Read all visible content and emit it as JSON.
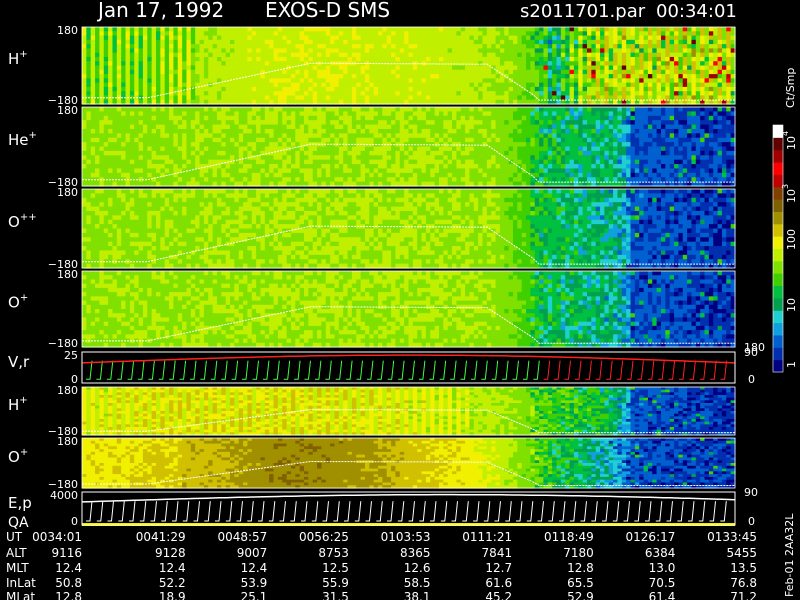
{
  "header": {
    "date": "Jan 17, 1992",
    "mission": "EXOS-D SMS",
    "file": "s2011701.par",
    "time": "00:34:01"
  },
  "colors": {
    "background": "#000000",
    "text": "#ffffff",
    "trace": "#ffffff",
    "vr_red": "#ff2020",
    "vr_green": "#40ff40"
  },
  "colorbar": {
    "unit": "Ct/Smp",
    "tick_labels": [
      "1",
      "10",
      "100",
      "10",
      "4",
      "10",
      "3"
    ],
    "scale": "log",
    "range": [
      1,
      10000
    ],
    "palette": [
      "#000080",
      "#0030b0",
      "#0060d0",
      "#10a0e0",
      "#20d0d0",
      "#00a050",
      "#00c040",
      "#40d000",
      "#80e000",
      "#c0f000",
      "#f0f000",
      "#d0c000",
      "#a09000",
      "#806000",
      "#804000",
      "#c00000",
      "#ff0000",
      "#a00000",
      "#600000",
      "#ffffff"
    ]
  },
  "chart_data": [
    {
      "type": "heatmap",
      "name": "H+",
      "label_main": "H",
      "label_sup": "+",
      "ylim": [
        -180,
        180
      ],
      "y_ticks": [
        "180",
        "−180"
      ],
      "profile": [
        [
          0,
          60
        ],
        [
          0.09,
          60
        ],
        [
          0.14,
          80
        ],
        [
          0.22,
          100
        ],
        [
          0.35,
          120
        ],
        [
          0.48,
          110
        ],
        [
          0.58,
          100
        ],
        [
          0.66,
          70
        ],
        [
          0.7,
          25
        ],
        [
          0.72,
          15
        ],
        [
          0.8,
          110
        ],
        [
          0.88,
          130
        ],
        [
          1,
          140
        ]
      ],
      "pattern": "stripes-both"
    },
    {
      "type": "heatmap",
      "name": "He+",
      "label_main": "He",
      "label_sup": "+",
      "ylim": [
        -180,
        180
      ],
      "y_ticks": [
        "180",
        "−180"
      ],
      "profile": [
        [
          0,
          70
        ],
        [
          0.2,
          75
        ],
        [
          0.35,
          80
        ],
        [
          0.5,
          80
        ],
        [
          0.62,
          75
        ],
        [
          0.67,
          45
        ],
        [
          0.7,
          20
        ],
        [
          0.76,
          18
        ],
        [
          0.82,
          12
        ],
        [
          0.84,
          3
        ],
        [
          1,
          2
        ]
      ],
      "pattern": "noise"
    },
    {
      "type": "heatmap",
      "name": "O++",
      "label_main": "O",
      "label_sup": "++",
      "ylim": [
        -180,
        180
      ],
      "y_ticks": [
        "180",
        "−180"
      ],
      "profile": [
        [
          0,
          70
        ],
        [
          0.2,
          75
        ],
        [
          0.35,
          80
        ],
        [
          0.5,
          80
        ],
        [
          0.62,
          75
        ],
        [
          0.67,
          45
        ],
        [
          0.7,
          20
        ],
        [
          0.76,
          16
        ],
        [
          0.82,
          10
        ],
        [
          0.84,
          3
        ],
        [
          1,
          2
        ]
      ],
      "pattern": "noise"
    },
    {
      "type": "heatmap",
      "name": "O+",
      "label_main": "O",
      "label_sup": "+",
      "ylim": [
        -180,
        180
      ],
      "y_ticks": [
        "180",
        "−180"
      ],
      "profile": [
        [
          0,
          70
        ],
        [
          0.2,
          75
        ],
        [
          0.35,
          80
        ],
        [
          0.5,
          80
        ],
        [
          0.62,
          75
        ],
        [
          0.67,
          45
        ],
        [
          0.7,
          20
        ],
        [
          0.76,
          16
        ],
        [
          0.82,
          10
        ],
        [
          0.84,
          3
        ],
        [
          1,
          2
        ]
      ],
      "pattern": "noise",
      "right_axis": [
        "180"
      ]
    },
    {
      "type": "line",
      "name": "V,r",
      "label_main": "V,r",
      "ylim": [
        0,
        25
      ],
      "y_ticks": [
        "25",
        "0"
      ],
      "right_axis": [
        "90",
        "0"
      ],
      "marker_count": 62,
      "green_until_fraction": 0.7
    },
    {
      "type": "heatmap",
      "name": "H+ (high energy)",
      "label_main": "H",
      "label_sup": "+",
      "ylim": [
        -180,
        180
      ],
      "y_ticks": [
        "180",
        "−180"
      ],
      "profile": [
        [
          0,
          125
        ],
        [
          0.08,
          150
        ],
        [
          0.3,
          160
        ],
        [
          0.48,
          140
        ],
        [
          0.6,
          100
        ],
        [
          0.66,
          70
        ],
        [
          0.7,
          40
        ],
        [
          0.78,
          25
        ],
        [
          0.84,
          3
        ],
        [
          1,
          2
        ]
      ],
      "pattern": "stripes-left"
    },
    {
      "type": "heatmap",
      "name": "O+ (high energy)",
      "label_main": "O",
      "label_sup": "+",
      "ylim": [
        -180,
        180
      ],
      "y_ticks": [
        "180",
        "−180"
      ],
      "profile": [
        [
          0,
          220
        ],
        [
          0.2,
          300
        ],
        [
          0.3,
          500
        ],
        [
          0.42,
          420
        ],
        [
          0.5,
          250
        ],
        [
          0.6,
          160
        ],
        [
          0.66,
          70
        ],
        [
          0.72,
          25
        ],
        [
          0.8,
          8
        ],
        [
          0.84,
          3
        ],
        [
          1,
          2
        ]
      ],
      "pattern": "blocks"
    },
    {
      "type": "line",
      "name": "E,p QA",
      "label_main": "E,p",
      "label_sub": "QA",
      "ylim": [
        0,
        4000
      ],
      "y_ticks": [
        "4000",
        "0"
      ],
      "right_axis": [
        "90",
        "0"
      ],
      "marker_count": 60
    }
  ],
  "ephemeris": {
    "row_labels": [
      "UT",
      "ALT",
      "MLT",
      "InLat",
      "MLat"
    ],
    "columns": [
      {
        "UT": "0034:01",
        "ALT": "9116",
        "MLT": "12.4",
        "InLat": "50.8",
        "MLat": "12.8"
      },
      {
        "UT": "0041:29",
        "ALT": "9128",
        "MLT": "12.4",
        "InLat": "52.2",
        "MLat": "18.9"
      },
      {
        "UT": "0048:57",
        "ALT": "9007",
        "MLT": "12.4",
        "InLat": "53.9",
        "MLat": "25.1"
      },
      {
        "UT": "0056:25",
        "ALT": "8753",
        "MLT": "12.5",
        "InLat": "55.9",
        "MLat": "31.5"
      },
      {
        "UT": "0103:53",
        "ALT": "8365",
        "MLT": "12.6",
        "InLat": "58.5",
        "MLat": "38.1"
      },
      {
        "UT": "0111:21",
        "ALT": "7841",
        "MLT": "12.7",
        "InLat": "61.6",
        "MLat": "45.2"
      },
      {
        "UT": "0118:49",
        "ALT": "7180",
        "MLT": "12.8",
        "InLat": "65.5",
        "MLat": "52.9"
      },
      {
        "UT": "0126:17",
        "ALT": "6384",
        "MLT": "13.0",
        "InLat": "70.5",
        "MLat": "61.4"
      },
      {
        "UT": "0133:45",
        "ALT": "5455",
        "MLT": "13.5",
        "InLat": "76.8",
        "MLat": "71.2"
      }
    ]
  },
  "footer": {
    "stamp": "Feb-01 2AA32L"
  }
}
